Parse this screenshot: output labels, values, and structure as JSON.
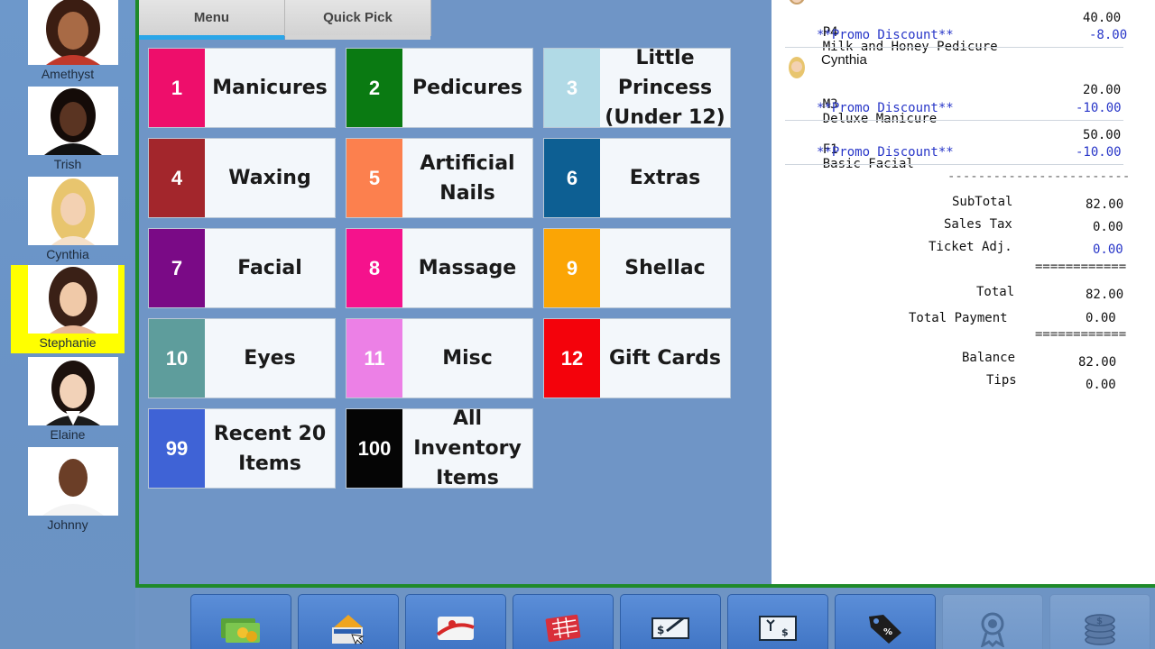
{
  "staff": [
    {
      "name": "Amethyst",
      "selected": false
    },
    {
      "name": "Trish",
      "selected": false
    },
    {
      "name": "Cynthia",
      "selected": false
    },
    {
      "name": "Stephanie",
      "selected": true
    },
    {
      "name": "Elaine",
      "selected": false
    },
    {
      "name": "Johnny",
      "selected": false
    }
  ],
  "tabs": {
    "menu": "Menu",
    "quick_pick": "Quick Pick"
  },
  "categories": [
    {
      "num": "1",
      "label": "Manicures",
      "color": "#ee0e6b"
    },
    {
      "num": "2",
      "label": "Pedicures",
      "color": "#0a7a12"
    },
    {
      "num": "3",
      "label": "Little Princess (Under 12)",
      "color": "#b1dae6"
    },
    {
      "num": "4",
      "label": "Waxing",
      "color": "#a3262c"
    },
    {
      "num": "5",
      "label": "Artificial Nails",
      "color": "#fc804e"
    },
    {
      "num": "6",
      "label": "Extras",
      "color": "#0d5f93"
    },
    {
      "num": "7",
      "label": "Facial",
      "color": "#7a0a86"
    },
    {
      "num": "8",
      "label": "Massage",
      "color": "#f5128c"
    },
    {
      "num": "9",
      "label": "Shellac",
      "color": "#fba505"
    },
    {
      "num": "10",
      "label": "Eyes",
      "color": "#5e9d9c"
    },
    {
      "num": "11",
      "label": "Misc",
      "color": "#ec80e6"
    },
    {
      "num": "12",
      "label": "Gift Cards",
      "color": "#f4020b"
    },
    {
      "num": "99",
      "label": "Recent 20 Items",
      "color": "#3f63d6"
    },
    {
      "num": "100",
      "label": "All Inventory Items",
      "color": "#050505"
    }
  ],
  "ticket": {
    "lines": [
      {
        "code": "P4",
        "desc": "Milk and Honey Pedicure",
        "amount": "40.00"
      },
      {
        "promo": "**Promo Discount**",
        "amount": "-8.00"
      },
      {
        "customer": "Cynthia"
      },
      {
        "code": "M3",
        "desc": "Deluxe Manicure",
        "amount": "20.00"
      },
      {
        "promo": "**Promo Discount**",
        "amount": "-10.00"
      },
      {
        "code": "F1",
        "desc": "Basic Facial",
        "amount": "50.00"
      },
      {
        "promo": "**Promo Discount**",
        "amount": "-10.00"
      }
    ],
    "dash_sep": "------------------------",
    "eq_sep": "============",
    "subtotal_label": "SubTotal",
    "subtotal": "82.00",
    "tax_label": "Sales Tax",
    "tax": "0.00",
    "adj_label": "Ticket Adj.",
    "adj": "0.00",
    "total_label": "Total",
    "total": "82.00",
    "payment_label": "Total Payment",
    "payment": "0.00",
    "balance_label": "Balance",
    "balance": "82.00",
    "tips_label": "Tips",
    "tips": "0.00"
  },
  "toolbar": [
    {
      "icon": "cash-payment-icon",
      "enabled": true
    },
    {
      "icon": "card-payment-icon",
      "enabled": true
    },
    {
      "icon": "gift-card-icon",
      "enabled": true
    },
    {
      "icon": "coupon-icon",
      "enabled": true
    },
    {
      "icon": "check-payment-icon",
      "enabled": true
    },
    {
      "icon": "gift-certificate-icon",
      "enabled": true
    },
    {
      "icon": "discount-tag-icon",
      "enabled": true
    },
    {
      "icon": "loyalty-award-icon",
      "enabled": false
    },
    {
      "icon": "coins-icon",
      "enabled": false
    }
  ]
}
